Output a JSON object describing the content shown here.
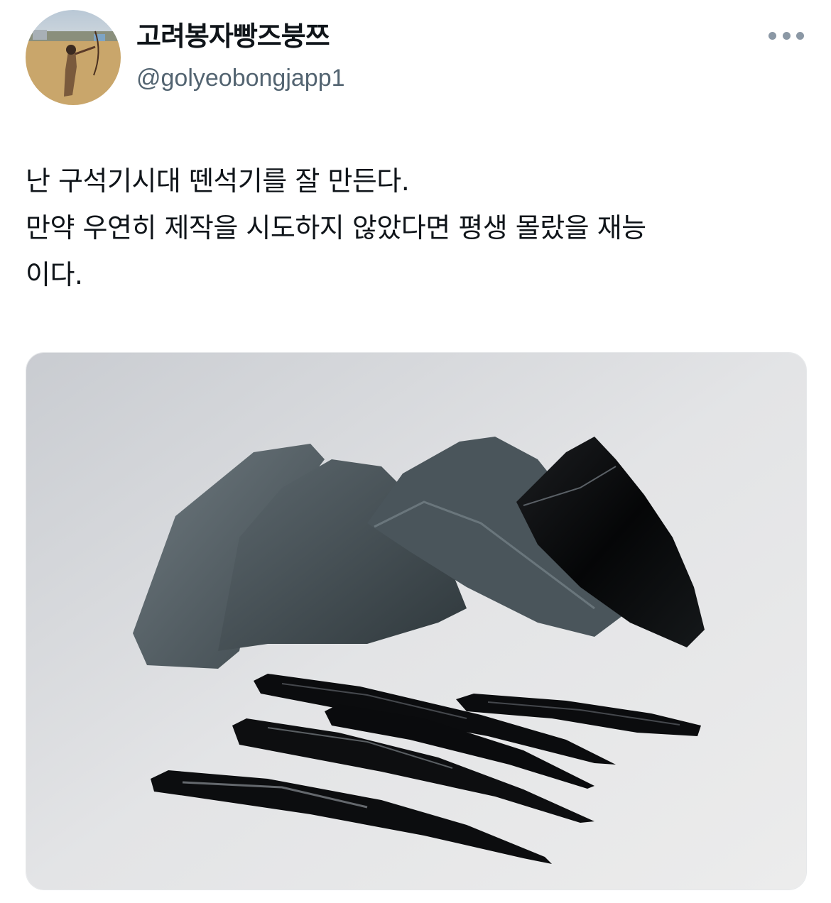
{
  "author": {
    "display_name": "고려봉자빵즈붕쯔",
    "handle": "@golyeobongjapp1"
  },
  "tweet": {
    "lines": [
      "난 구석기시대 뗀석기를 잘 만든다.",
      "만약 우연히 제작을 시도하지 않았다면 평생 몰랐을 재능",
      "이다."
    ]
  },
  "icons": {
    "more": "more-horizontal-icon"
  },
  "colors": {
    "text": "#0f1419",
    "secondary": "#536471",
    "more_dots": "#8b98a5"
  }
}
